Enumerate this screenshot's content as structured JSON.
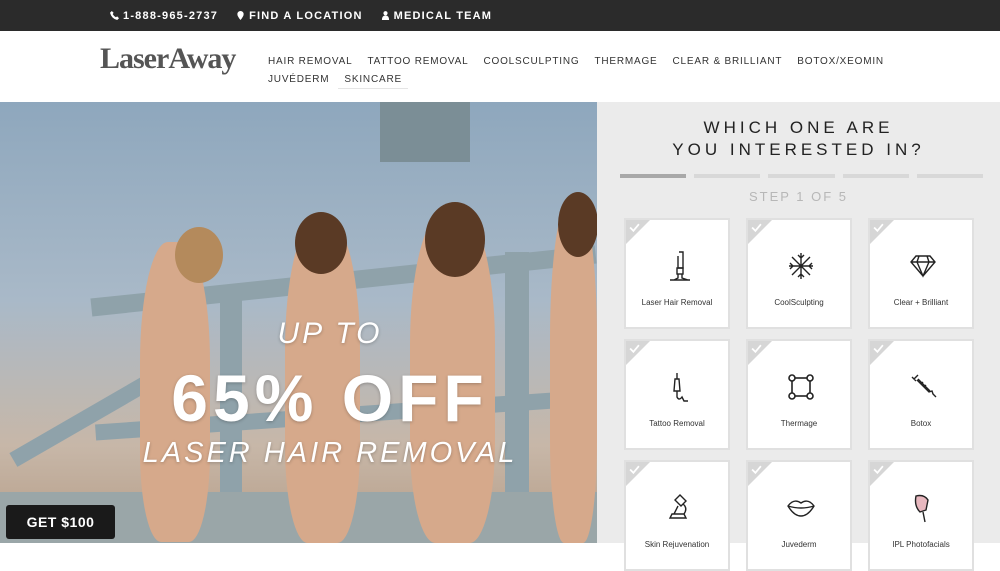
{
  "topbar": {
    "phone": "1-888-965-2737",
    "location": "FIND A LOCATION",
    "medical": "MEDICAL TEAM"
  },
  "brand": {
    "logo": "LaserAway"
  },
  "nav": [
    "HAIR REMOVAL",
    "TATTOO REMOVAL",
    "COOLSCULPTING",
    "THERMAGE",
    "CLEAR & BRILLIANT",
    "BOTOX/XEOMIN",
    "JUVÉDERM",
    "SKINCARE"
  ],
  "hero": {
    "upto": "UP TO",
    "main": "65% OFF",
    "sub": "LASER HAIR REMOVAL",
    "cta": "GET $100"
  },
  "quiz": {
    "title_line1": "WHICH ONE ARE",
    "title_line2": "YOU INTERESTED IN?",
    "step_label": "STEP 1 OF 5",
    "step_current": 1,
    "step_total": 5,
    "options": [
      {
        "label": "Laser Hair Removal",
        "icon": "laser-device-icon"
      },
      {
        "label": "CoolSculpting",
        "icon": "snowflake-icon"
      },
      {
        "label": "Clear + Brilliant",
        "icon": "diamond-icon"
      },
      {
        "label": "Tattoo Removal",
        "icon": "tattoo-pen-icon"
      },
      {
        "label": "Thermage",
        "icon": "square-nodes-icon"
      },
      {
        "label": "Botox",
        "icon": "syringe-icon"
      },
      {
        "label": "Skin Rejuvenation",
        "icon": "microscope-icon"
      },
      {
        "label": "Juvederm",
        "icon": "lips-icon"
      },
      {
        "label": "IPL Photofacials",
        "icon": "ipl-device-icon"
      }
    ]
  },
  "colors": {
    "topbar": "#2b2b2b",
    "panel": "#ebebeb",
    "cta": "#1a1a1a"
  }
}
